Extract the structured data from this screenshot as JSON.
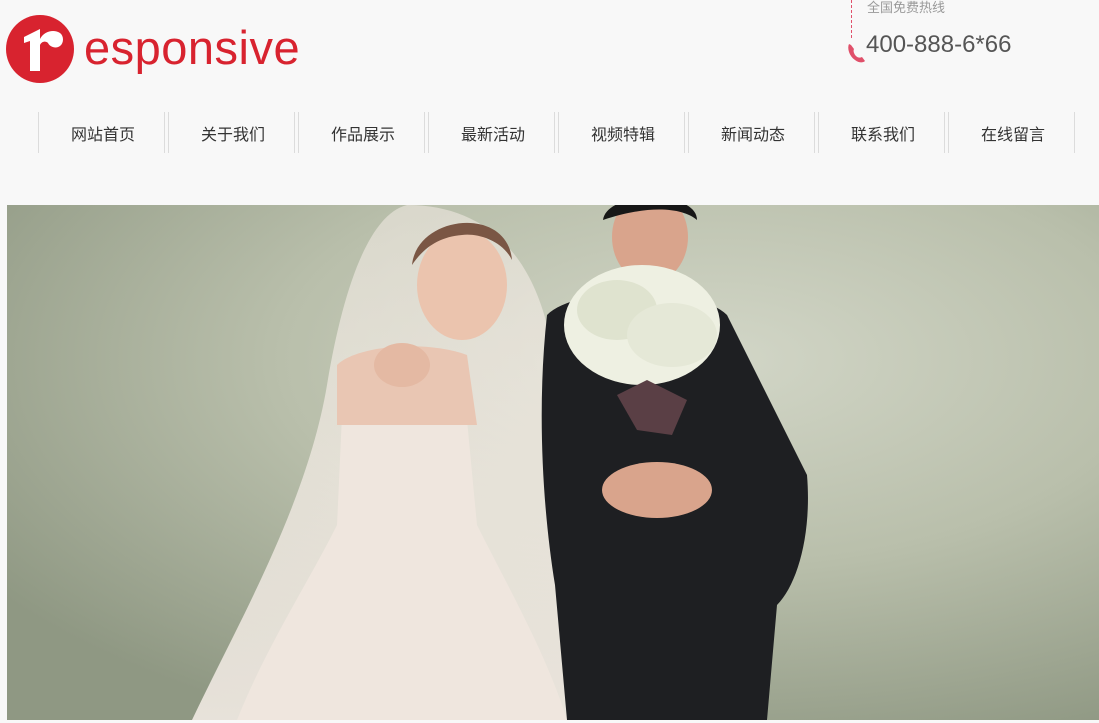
{
  "logo": {
    "text": "esponsive",
    "mark_letter": "r",
    "brand_color": "#d8232f"
  },
  "hotline": {
    "label": "全国免费热线",
    "number": "400-888-6*66",
    "icon": "phone-icon"
  },
  "nav": {
    "items": [
      {
        "label": "网站首页"
      },
      {
        "label": "关于我们"
      },
      {
        "label": "作品展示"
      },
      {
        "label": "最新活动"
      },
      {
        "label": "视频特辑"
      },
      {
        "label": "新闻动态"
      },
      {
        "label": "联系我们"
      },
      {
        "label": "在线留言"
      }
    ]
  },
  "banner": {
    "image": "wedding-couple-photo"
  }
}
